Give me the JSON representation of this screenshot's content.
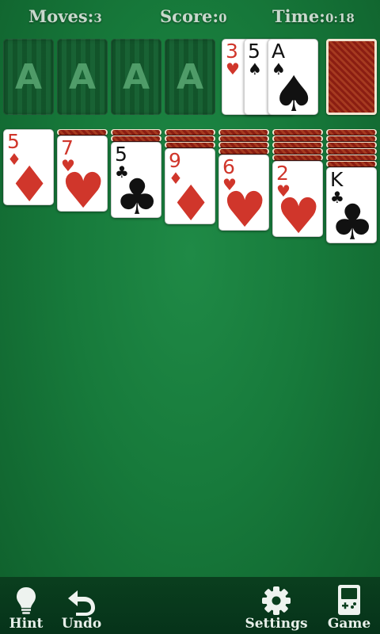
{
  "header": {
    "moves_label": "Moves:",
    "moves_value": "3",
    "score_label": "Score:",
    "score_value": "0",
    "time_label": "Time:",
    "time_value": "0:18"
  },
  "foundations": [
    "A",
    "A",
    "A",
    "A"
  ],
  "waste": [
    {
      "rank": "3",
      "suit": "♥",
      "color": "red"
    },
    {
      "rank": "5",
      "suit": "♠",
      "color": "black"
    },
    {
      "rank": "A",
      "suit": "♠",
      "color": "black"
    }
  ],
  "tableau": [
    {
      "hidden": 0,
      "rank": "5",
      "suit": "♦",
      "color": "red"
    },
    {
      "hidden": 1,
      "rank": "7",
      "suit": "♥",
      "color": "red"
    },
    {
      "hidden": 2,
      "rank": "5",
      "suit": "♣",
      "color": "black"
    },
    {
      "hidden": 3,
      "rank": "9",
      "suit": "♦",
      "color": "red"
    },
    {
      "hidden": 4,
      "rank": "6",
      "suit": "♥",
      "color": "red"
    },
    {
      "hidden": 5,
      "rank": "2",
      "suit": "♥",
      "color": "red"
    },
    {
      "hidden": 6,
      "rank": "K",
      "suit": "♣",
      "color": "black"
    }
  ],
  "toolbar": {
    "hint": "Hint",
    "undo": "Undo",
    "settings": "Settings",
    "game": "Game",
    "icons": [
      "lightbulb-icon",
      "undo-arrow-icon",
      "gear-icon",
      "gameboy-icon"
    ]
  },
  "colors": {
    "felt": "#177a3b",
    "red_suit": "#d0362b",
    "black_suit": "#111111",
    "card_back": "#8b1d12"
  }
}
